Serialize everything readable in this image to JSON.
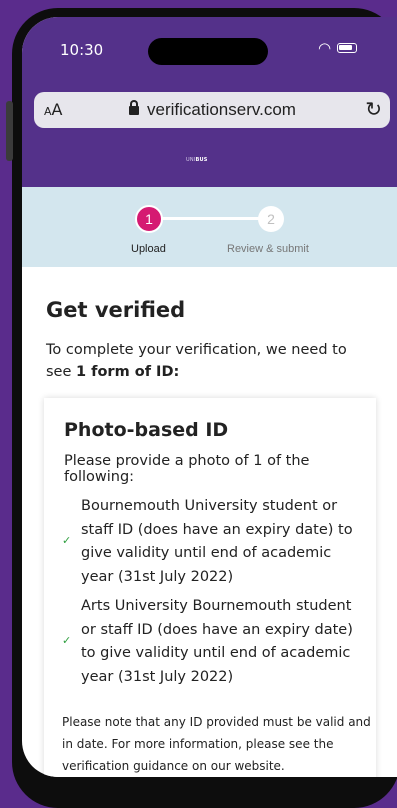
{
  "status_bar": {
    "time": "10:30"
  },
  "browser": {
    "text_size_label": "AA",
    "url": "verificationserv.com",
    "icons": [
      "lock-icon",
      "reload-icon",
      "wifi-icon",
      "battery-icon"
    ]
  },
  "site": {
    "logo_prefix": "UNI",
    "logo_bold": "BUS"
  },
  "steps": [
    {
      "number": "1",
      "label": "Upload",
      "active": true
    },
    {
      "number": "2",
      "label": "Review & submit",
      "active": false
    }
  ],
  "page": {
    "title": "Get verified",
    "intro_text": "To complete your verification, we need to see ",
    "intro_bold": "1 form of ID:"
  },
  "card": {
    "title": "Photo-based ID",
    "description": "Please provide a photo of 1 of the following:",
    "items": [
      "Bournemouth University student or staff ID (does have an expiry date) to give validity until end of academic year (31st July 2022)",
      "Arts University Bournemouth student or staff ID (does have an expiry date) to give validity until end of academic year (31st July 2022)"
    ],
    "note": "Please note that any ID provided must be valid and in date. For more information, please see the verification guidance on our website."
  },
  "colors": {
    "brand_purple": "#54318a",
    "step_active": "#d51a72",
    "steps_background": "#d3e6ee",
    "check_green": "#2e9e3e"
  }
}
